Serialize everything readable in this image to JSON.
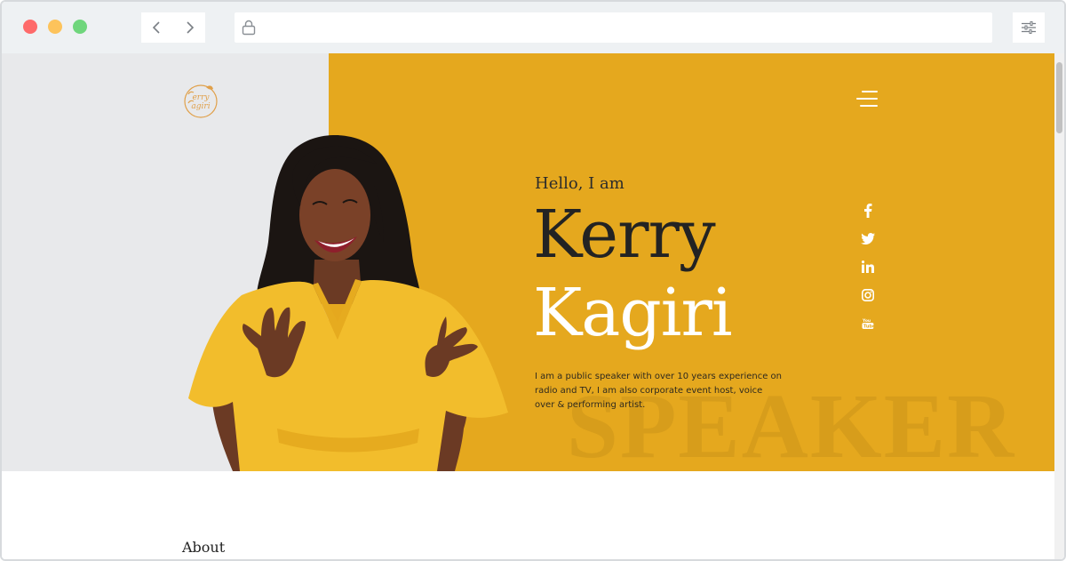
{
  "browser": {
    "back_icon": "chevron-left-icon",
    "forward_icon": "chevron-right-icon",
    "lock_icon": "lock-icon",
    "url": "",
    "settings_icon": "sliders-icon"
  },
  "site": {
    "logo_text": "Kerry Kagiri",
    "menu_icon": "hamburger-menu-icon",
    "accent_color": "#e5a81e",
    "left_panel_color": "#e8e9eb"
  },
  "hero": {
    "greeting": "Hello, I am",
    "first_name": "Kerry",
    "last_name": "Kagiri",
    "bio": "I am a public speaker with over 10 years experience on radio and TV, I am also corporate event host, voice over & performing artist.",
    "watermark": "SPEAKER"
  },
  "social": [
    {
      "name": "facebook-icon"
    },
    {
      "name": "twitter-icon"
    },
    {
      "name": "linkedin-icon"
    },
    {
      "name": "instagram-icon"
    },
    {
      "name": "youtube-icon"
    }
  ],
  "about": {
    "heading": "About"
  }
}
